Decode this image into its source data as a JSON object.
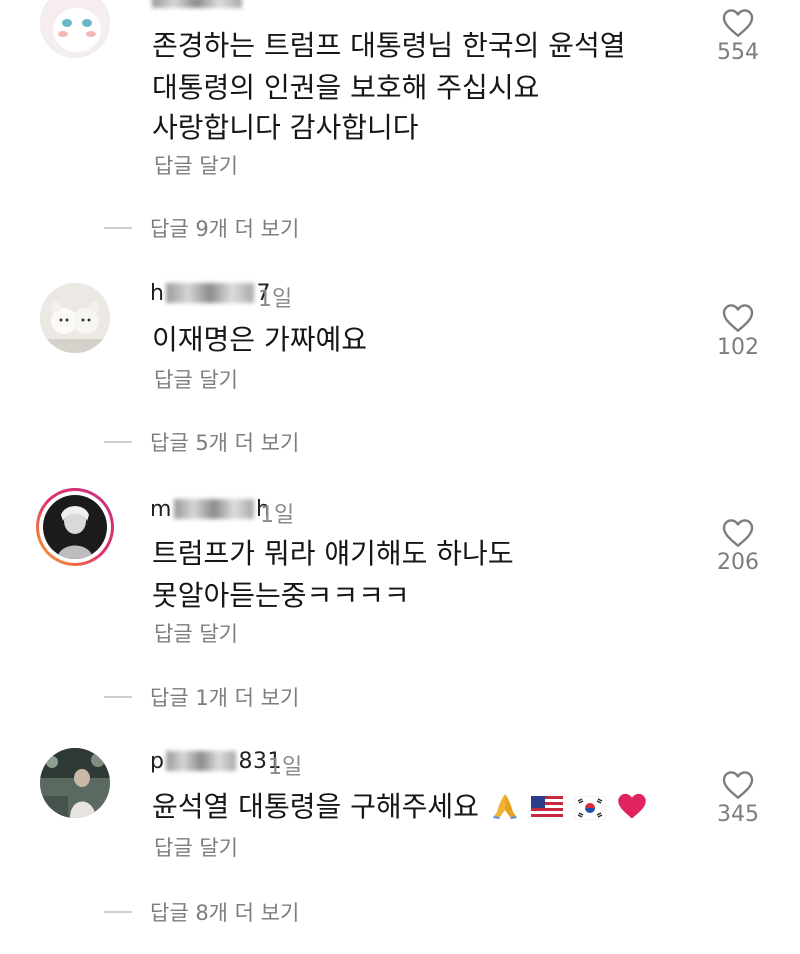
{
  "comments": [
    {
      "username": "",
      "timestamp": "",
      "text_lines": [
        "존경하는 트럼프 대통령님 한국의 윤석열",
        "대통령의 인권을 보호해 주십시요",
        "사랑합니다 감사합니다"
      ],
      "reply_label": "답글 달기",
      "view_replies": "답글 9개 더 보기",
      "likes": "554"
    },
    {
      "username": "h",
      "username_end": "7",
      "timestamp": "1일",
      "text_lines": [
        "이재명은 가짜예요"
      ],
      "reply_label": "답글 달기",
      "view_replies": "답글 5개 더 보기",
      "likes": "102"
    },
    {
      "username": "m",
      "username_end": "h",
      "timestamp": "1일",
      "text_lines": [
        "트럼프가 뭐라 얘기해도 하나도",
        "못알아듣는중ㅋㅋㅋㅋ"
      ],
      "reply_label": "답글 달기",
      "view_replies": "답글 1개 더 보기",
      "likes": "206"
    },
    {
      "username": "p",
      "username_end": "831",
      "timestamp": "1일",
      "text_lines": [
        "윤석열 대통령을 구해주세요"
      ],
      "reply_label": "답글 달기",
      "view_replies": "답글 8개 더 보기",
      "likes": "345"
    }
  ],
  "icons": {
    "like": "heart-outline-icon",
    "emojis": [
      "folded-hands-emoji",
      "us-flag-emoji",
      "korea-flag-emoji",
      "red-heart-emoji"
    ]
  },
  "colors": {
    "text": "#161616",
    "meta": "#7d7d7d",
    "story_ring_start": "#f9a825",
    "story_ring_end": "#c13584",
    "heart_emoji": "#e0245e"
  }
}
